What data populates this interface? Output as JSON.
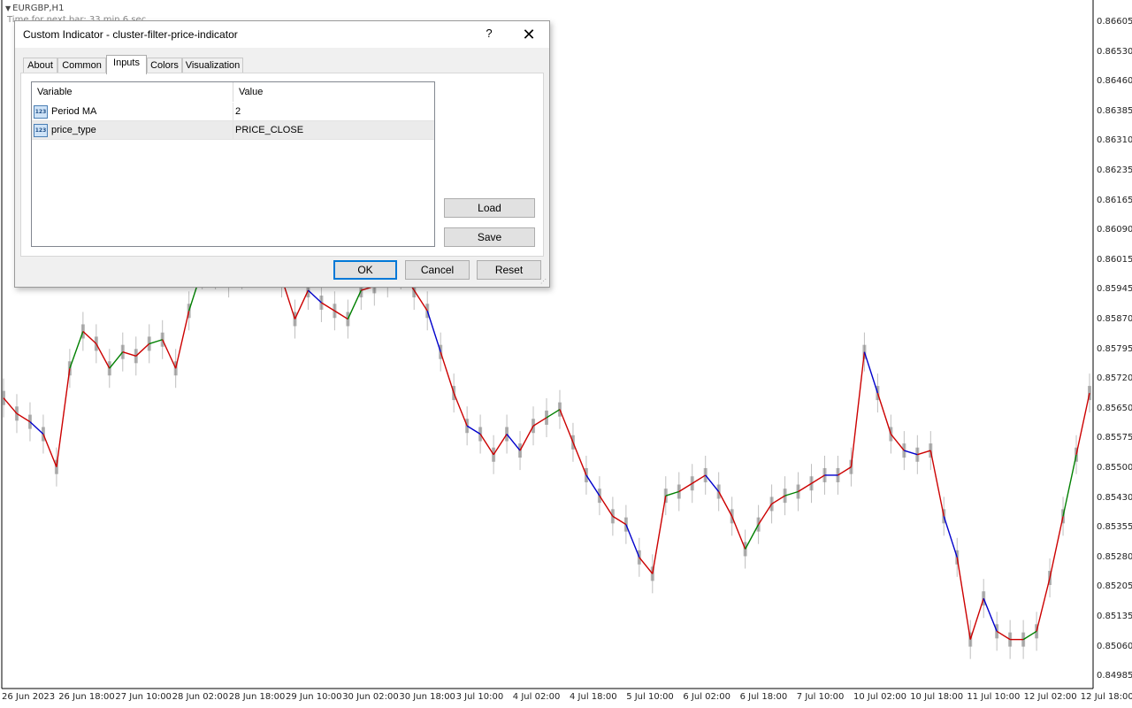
{
  "chart": {
    "symbol": "EURGBP,H1",
    "timer_text": "Time for next bar: 33 min 6 sec",
    "price_axis": [
      "0.86605",
      "0.86530",
      "0.86460",
      "0.86385",
      "0.86310",
      "0.86235",
      "0.86165",
      "0.86090",
      "0.86015",
      "0.85945",
      "0.85870",
      "0.85795",
      "0.85720",
      "0.85650",
      "0.85575",
      "0.85500",
      "0.85430",
      "0.85355",
      "0.85280",
      "0.85205",
      "0.85135",
      "0.85060",
      "0.84985"
    ],
    "time_axis": [
      "26 Jun 2023",
      "26 Jun 18:00",
      "27 Jun 10:00",
      "28 Jun 02:00",
      "28 Jun 18:00",
      "29 Jun 10:00",
      "30 Jun 02:00",
      "30 Jun 18:00",
      "3 Jul 10:00",
      "4 Jul 02:00",
      "4 Jul 18:00",
      "5 Jul 10:00",
      "6 Jul 02:00",
      "6 Jul 18:00",
      "7 Jul 10:00",
      "10 Jul 02:00",
      "10 Jul 18:00",
      "11 Jul 10:00",
      "12 Jul 02:00",
      "12 Jul 18:00"
    ],
    "colors": {
      "bars": "#7a7a7a",
      "wick": "#bfbfbf",
      "ma_line": "#cc0000",
      "up_segment": "#008000",
      "down_segment": "#0000cc"
    },
    "price_path": [
      0.85688,
      0.8565,
      0.8563,
      0.856,
      0.8552,
      0.8576,
      0.8585,
      0.8582,
      0.8576,
      0.858,
      0.8579,
      0.8582,
      0.8583,
      0.8576,
      0.859,
      0.86,
      0.86,
      0.8598,
      0.86,
      0.8605,
      0.861,
      0.8598,
      0.8588,
      0.8595,
      0.8592,
      0.859,
      0.8588,
      0.8595,
      0.8596,
      0.8598,
      0.86,
      0.8595,
      0.859,
      0.858,
      0.857,
      0.8562,
      0.856,
      0.8555,
      0.856,
      0.8556,
      0.8562,
      0.8564,
      0.8566,
      0.8558,
      0.855,
      0.8545,
      0.854,
      0.8538,
      0.853,
      0.8526,
      0.8545,
      0.8546,
      0.8548,
      0.855,
      0.8546,
      0.854,
      0.8532,
      0.8538,
      0.8543,
      0.8545,
      0.8546,
      0.8548,
      0.855,
      0.855,
      0.8552,
      0.858,
      0.857,
      0.856,
      0.8556,
      0.8555,
      0.8556,
      0.854,
      0.853,
      0.851,
      0.852,
      0.8512,
      0.851,
      0.851,
      0.8512,
      0.8525,
      0.854,
      0.8555,
      0.857
    ]
  },
  "dialog": {
    "title": "Custom Indicator - cluster-filter-price-indicator",
    "help": "?",
    "close": "✕",
    "tabs": [
      "About",
      "Common",
      "Inputs",
      "Colors",
      "Visualization"
    ],
    "active_tab": "Inputs",
    "grid": {
      "headers": [
        "Variable",
        "Value"
      ],
      "rows": [
        {
          "icon": "123",
          "variable": "Period MA",
          "value": "2"
        },
        {
          "icon": "123",
          "variable": "price_type",
          "value": "PRICE_CLOSE"
        }
      ]
    },
    "buttons": {
      "load": "Load",
      "save": "Save",
      "ok": "OK",
      "cancel": "Cancel",
      "reset": "Reset"
    }
  }
}
